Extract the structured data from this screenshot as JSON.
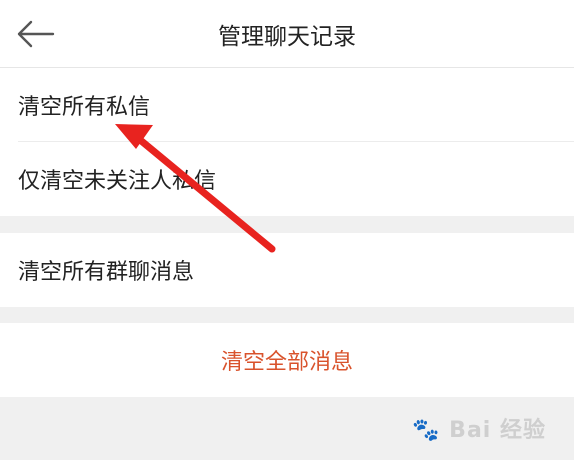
{
  "header": {
    "title": "管理聊天记录",
    "back_icon": "back-arrow-icon"
  },
  "group1": {
    "items": [
      {
        "label": "清空所有私信"
      },
      {
        "label": "仅清空未关注人私信"
      }
    ]
  },
  "group2": {
    "items": [
      {
        "label": "清空所有群聊消息"
      }
    ]
  },
  "group3": {
    "clear_all_label": "清空全部消息"
  },
  "watermark": {
    "text": "Bai 经验",
    "icon": "baidu-paw-icon"
  },
  "colors": {
    "danger": "#d9532c",
    "annotation_arrow": "#e8231f",
    "background": "#f0f0f0"
  }
}
